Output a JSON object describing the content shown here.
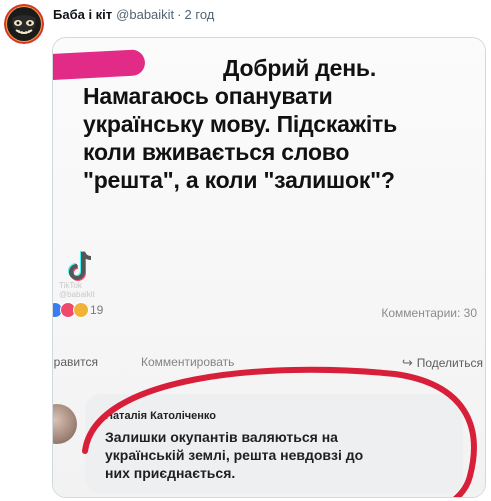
{
  "tweet": {
    "author_name": "Баба і кіт",
    "author_handle": "@babaikit",
    "separator": "·",
    "time": "2 год",
    "avatar_icon": "black-cat-avatar-icon"
  },
  "image": {
    "question_lines": [
      "Добрий день.",
      "Намагаюсь опанувати",
      "українську мову. Підскажіть",
      "коли вживається слово",
      "\"решта\", а коли \"залишок\"?"
    ],
    "watermark": {
      "icon": "tiktok-logo-icon",
      "text_top": "TikTok",
      "text_bottom": "@babaikit"
    },
    "reactions_count": "19",
    "comments_label": "Комментарии: 30",
    "actions": {
      "like": "Нравится",
      "comment": "Комментировать",
      "share": "Поделиться"
    },
    "highlight_color": "#d81f3a",
    "comment": {
      "author": "Наталія Католіченко",
      "text_lines": [
        "Залишки окупантів валяються на",
        "українській землі, решта невдовзі до",
        "них приєднається."
      ]
    }
  }
}
